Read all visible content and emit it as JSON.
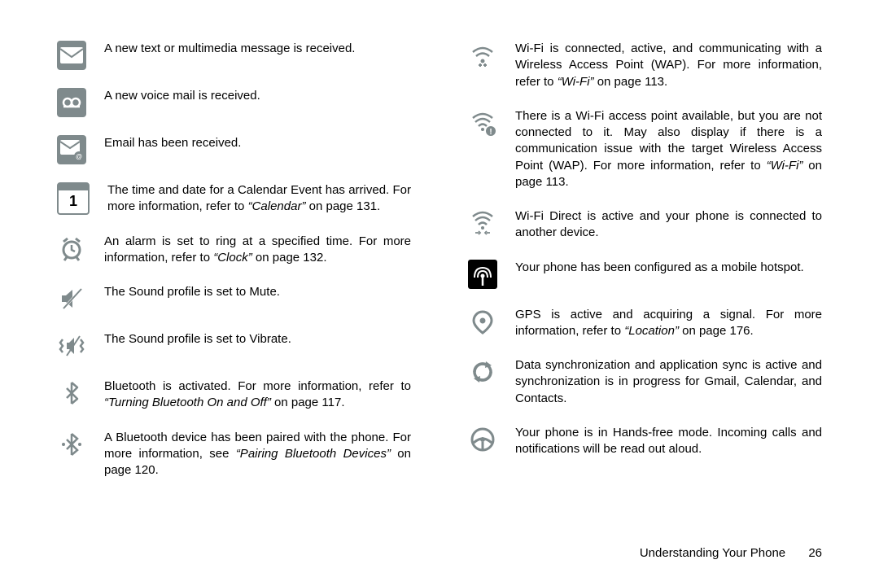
{
  "left": [
    {
      "id": "message",
      "text_parts": [
        {
          "t": "A new text or multimedia message is received."
        }
      ]
    },
    {
      "id": "voicemail",
      "text_parts": [
        {
          "t": "A new voice mail is received."
        }
      ]
    },
    {
      "id": "email",
      "text_parts": [
        {
          "t": "Email has been received."
        }
      ]
    },
    {
      "id": "calendar",
      "text_parts": [
        {
          "t": "The time and date for a Calendar Event has arrived. For more information, refer to "
        },
        {
          "t": "“Calendar”",
          "i": true
        },
        {
          "t": " on page 131."
        }
      ]
    },
    {
      "id": "alarm",
      "text_parts": [
        {
          "t": "An alarm is set to ring at a specified time. For more information, refer to "
        },
        {
          "t": "“Clock”",
          "i": true
        },
        {
          "t": " on page 132."
        }
      ]
    },
    {
      "id": "mute",
      "text_parts": [
        {
          "t": "The Sound profile is set to Mute."
        }
      ]
    },
    {
      "id": "vibrate",
      "text_parts": [
        {
          "t": "The Sound profile is set to Vibrate."
        }
      ]
    },
    {
      "id": "bluetooth",
      "text_parts": [
        {
          "t": "Bluetooth is activated. For more information, refer to "
        },
        {
          "t": "“Turning Bluetooth On and Off”",
          "i": true
        },
        {
          "t": " on page 117."
        }
      ]
    },
    {
      "id": "bt-paired",
      "text_parts": [
        {
          "t": "A Bluetooth device has been paired with the phone. For more information, see "
        },
        {
          "t": "“Pairing Bluetooth Devices”",
          "i": true
        },
        {
          "t": " on page 120."
        }
      ]
    }
  ],
  "right": [
    {
      "id": "wifi-connected",
      "text_parts": [
        {
          "t": "Wi-Fi is connected, active, and communicating with a Wireless Access Point (WAP). For more information, refer to "
        },
        {
          "t": "“Wi-Fi”",
          "i": true
        },
        {
          "t": " on page 113."
        }
      ]
    },
    {
      "id": "wifi-available",
      "text_parts": [
        {
          "t": "There is a Wi-Fi access point available, but you are not connected to it. May also display if there is a communication issue with the target Wireless Access Point (WAP). For more information, refer to "
        },
        {
          "t": "“Wi-Fi”",
          "i": true
        },
        {
          "t": " on page 113."
        }
      ]
    },
    {
      "id": "wifi-direct",
      "text_parts": [
        {
          "t": "Wi-Fi Direct is active and your phone is connected to another device."
        }
      ]
    },
    {
      "id": "hotspot",
      "text_parts": [
        {
          "t": "Your phone has been configured as a mobile hotspot."
        }
      ]
    },
    {
      "id": "gps",
      "text_parts": [
        {
          "t": "GPS is active and acquiring a signal. For more information, refer to "
        },
        {
          "t": "“Location”",
          "i": true
        },
        {
          "t": " on page 176."
        }
      ]
    },
    {
      "id": "sync",
      "text_parts": [
        {
          "t": "Data synchronization and application sync is active and synchronization is in progress for Gmail, Calendar, and Contacts."
        }
      ]
    },
    {
      "id": "handsfree",
      "text_parts": [
        {
          "t": "Your phone is in Hands-free mode. Incoming calls and notifications will be read out aloud."
        }
      ]
    }
  ],
  "footer": {
    "chapter": "Understanding Your Phone",
    "page": "26"
  },
  "icons": {
    "calendar_day": "1"
  }
}
